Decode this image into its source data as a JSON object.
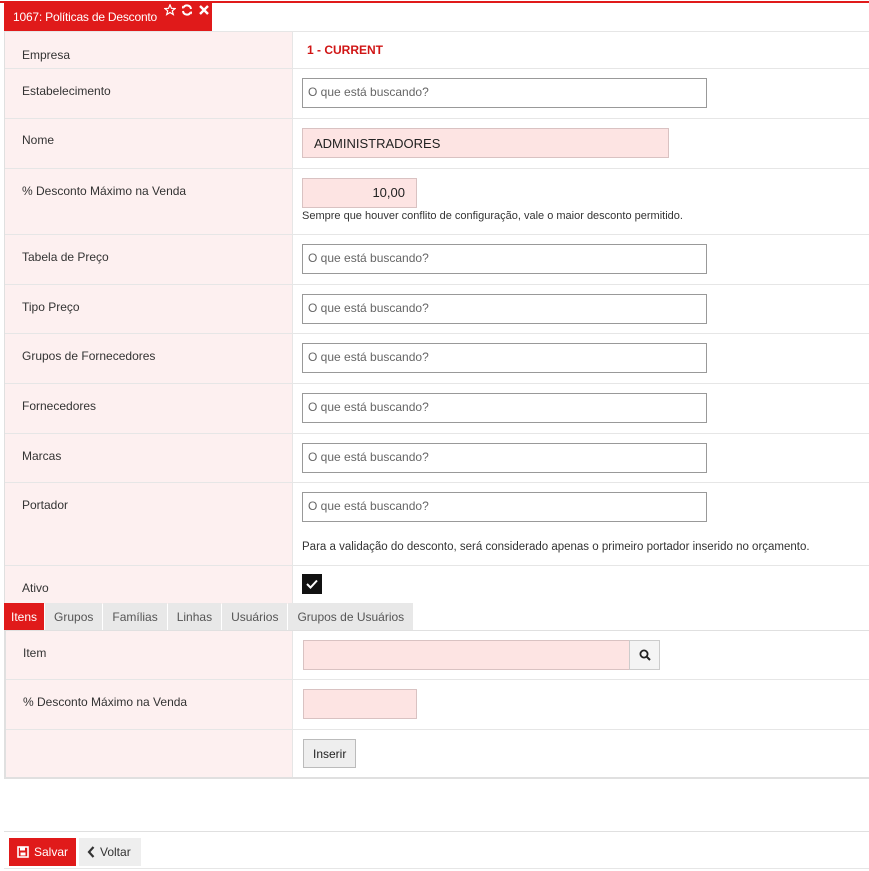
{
  "tab": {
    "title": "1067: Políticas de Desconto",
    "icons": [
      "star-icon",
      "refresh-icon",
      "close-icon"
    ]
  },
  "form": {
    "empresa": {
      "label": "Empresa",
      "value": "1 - CURRENT"
    },
    "estabelecimento": {
      "label": "Estabelecimento",
      "placeholder": "O que está buscando?"
    },
    "nome": {
      "label": "Nome",
      "value": "ADMINISTRADORES"
    },
    "desconto": {
      "label": "% Desconto Máximo na Venda",
      "value": "10,00",
      "help": "Sempre que houver conflito de configuração, vale o maior desconto permitido."
    },
    "tabela_preco": {
      "label": "Tabela de Preço",
      "placeholder": "O que está buscando?"
    },
    "tipo_preco": {
      "label": "Tipo Preço",
      "placeholder": "O que está buscando?"
    },
    "grupos_fornecedores": {
      "label": "Grupos de Fornecedores",
      "placeholder": "O que está buscando?"
    },
    "fornecedores": {
      "label": "Fornecedores",
      "placeholder": "O que está buscando?"
    },
    "marcas": {
      "label": "Marcas",
      "placeholder": "O que está buscando?"
    },
    "portador": {
      "label": "Portador",
      "placeholder": "O que está buscando?",
      "help": "Para a validação do desconto, será considerado apenas o primeiro portador inserido no orçamento."
    },
    "ativo": {
      "label": "Ativo",
      "checked": true
    }
  },
  "subtabs": [
    "Itens",
    "Grupos",
    "Famílias",
    "Linhas",
    "Usuários",
    "Grupos de Usuários"
  ],
  "itens": {
    "item_label": "Item",
    "desconto_label": "% Desconto Máximo na Venda",
    "insert_label": "Inserir"
  },
  "footer": {
    "save_label": "Salvar",
    "back_label": "Voltar"
  },
  "colors": {
    "accent": "#e01a1a",
    "field_pink": "#fde4e3",
    "label_bg": "#fdf0f0"
  }
}
